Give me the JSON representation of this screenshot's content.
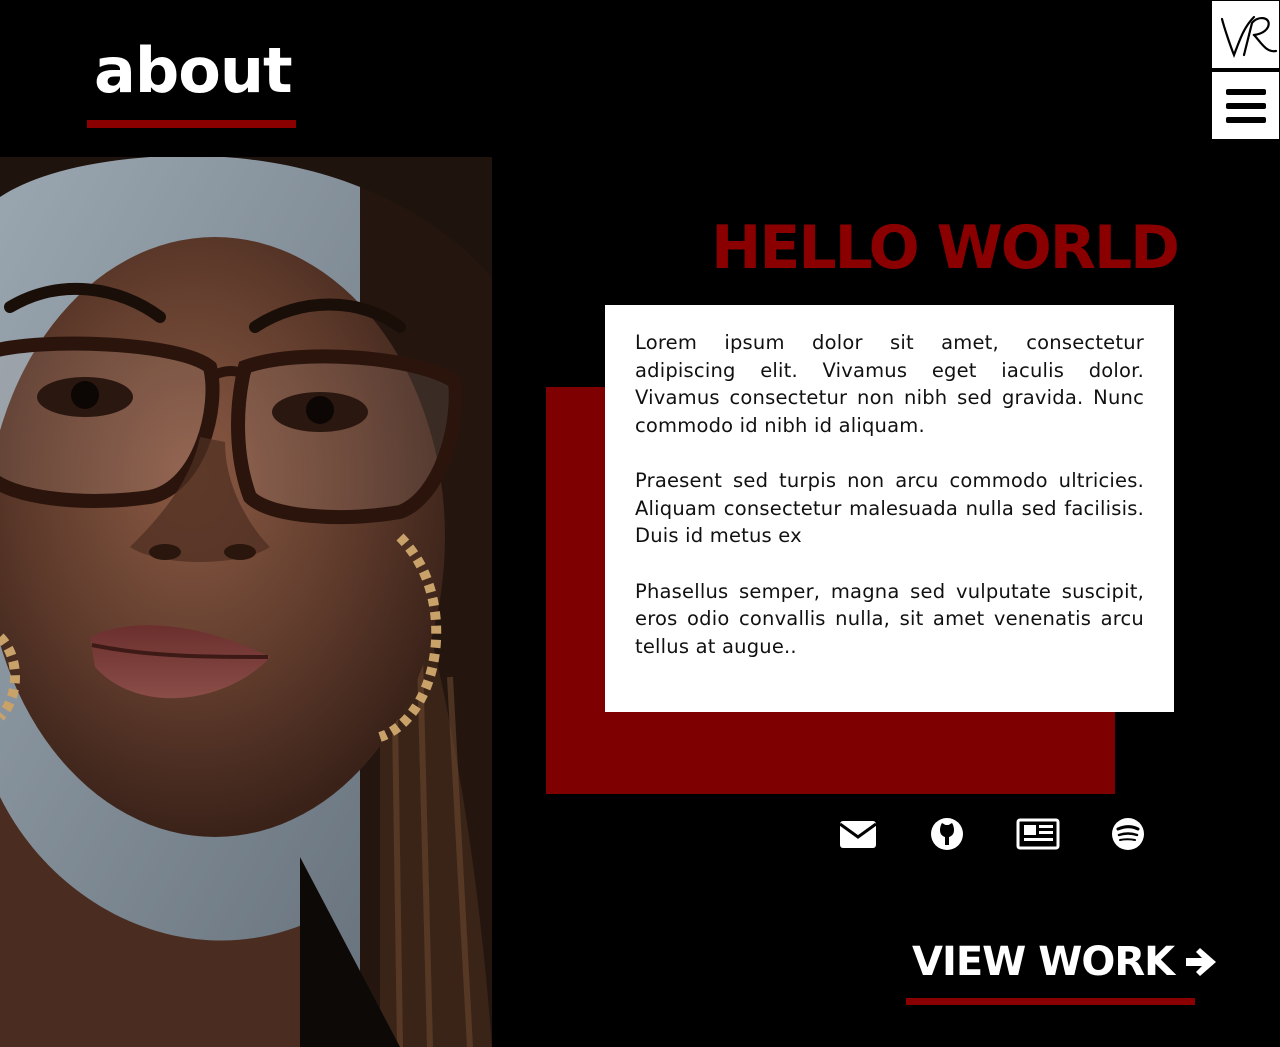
{
  "header": {
    "title": "about"
  },
  "logo": {
    "text": "VR"
  },
  "nav": {
    "menu_icon": "hamburger-menu-icon"
  },
  "portrait": {
    "description": "portrait"
  },
  "main": {
    "greeting": "HELLO WORLD",
    "bio_paragraphs": [
      "Lorem ipsum dolor sit amet, consectetur adipiscing elit. Vivamus eget iaculis dolor. Vivamus consectetur non nibh sed gravida. Nunc commodo id nibh id aliquam.",
      "Praesent sed turpis non arcu commodo ultricies. Aliquam consectetur malesuada nulla sed facilisis. Duis id metus ex",
      "Phasellus semper, magna sed vulputate suscipit, eros odio convallis nulla, sit amet venenatis arcu tellus at augue.."
    ]
  },
  "social": [
    {
      "icon": "envelope-icon"
    },
    {
      "icon": "github-icon"
    },
    {
      "icon": "newspaper-icon"
    },
    {
      "icon": "spotify-icon"
    }
  ],
  "cta": {
    "label": "VIEW WORK",
    "icon": "arrow-right-icon"
  },
  "colors": {
    "background": "#000000",
    "accent": "#8a0000",
    "card": "#ffffff",
    "text_light": "#ffffff",
    "text_dark": "#111111"
  }
}
